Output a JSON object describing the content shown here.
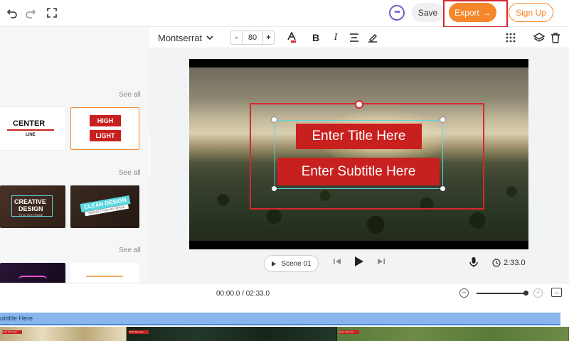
{
  "topbar": {
    "undo_icon": "undo-icon",
    "redo_icon": "redo-icon",
    "fullscreen_icon": "fullscreen-icon",
    "chat_icon": "chat-icon",
    "save_label": "Save",
    "export_label": "Export",
    "export_arrow": "→",
    "signup_label": "Sign Up"
  },
  "left_panel": {
    "sections": [
      {
        "see_all": "See all"
      },
      {
        "see_all": "See all"
      },
      {
        "see_all": "See all"
      }
    ],
    "templates": [
      {
        "line1": "CENTER",
        "line2": "LINE"
      },
      {
        "line1": "HIGH",
        "line2": "LIGHT"
      },
      {
        "line1": "CREATIVE",
        "line2": "DESIGN",
        "sub": "TITLE IN A FRAME"
      },
      {
        "line1": "CLEAN DESIGN",
        "sub": "PERFECT FOR ANY SPACE"
      }
    ],
    "collapse_glyph": "‹"
  },
  "toolbar": {
    "font_name": "Montserrat",
    "font_size": "80",
    "minus": "-",
    "plus": "+",
    "bold": "B",
    "italic": "I"
  },
  "canvas": {
    "title_text": "Enter Title Here",
    "subtitle_text": "Enter Subtitle Here"
  },
  "playback": {
    "scene_label": "Scene 01",
    "duration": "2:33.0"
  },
  "timeline": {
    "time_readout": "00:00.0 / 02:33.0",
    "track_label": "ubtitle Here",
    "thumb_caption": "Enter Title Here"
  },
  "colors": {
    "accent_orange": "#f5862a",
    "highlight_red": "#d7272e",
    "title_red": "#c8201e",
    "selection_cyan": "#5ad7e0",
    "track_blue": "#87b5ec"
  }
}
